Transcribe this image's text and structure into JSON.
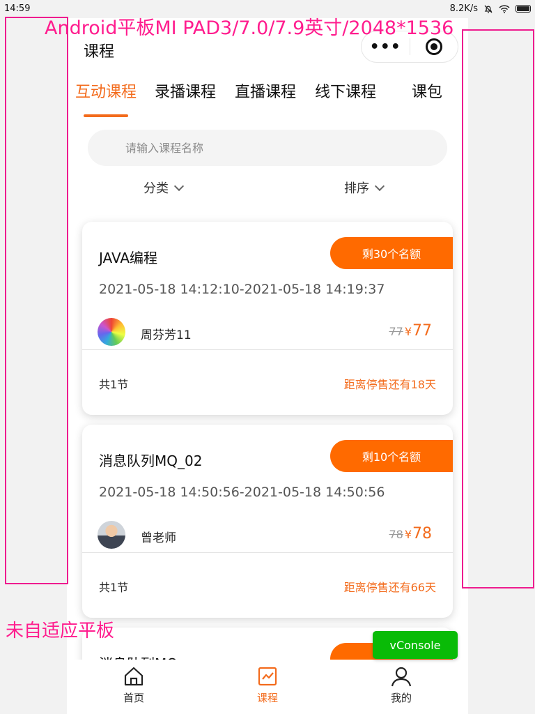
{
  "status_bar": {
    "time": "14:59",
    "net_speed": "8.2K/s"
  },
  "navbar": {
    "title": "课程",
    "more_label": "•••"
  },
  "tabs": [
    {
      "label": "互动课程",
      "active": true
    },
    {
      "label": "录播课程",
      "active": false
    },
    {
      "label": "直播课程",
      "active": false
    },
    {
      "label": "线下课程",
      "active": false
    },
    {
      "label": "课包",
      "active": false
    }
  ],
  "search": {
    "placeholder": "请输入课程名称",
    "value": ""
  },
  "filters": {
    "category": "分类",
    "sort": "排序"
  },
  "courses": [
    {
      "name": "JAVA编程",
      "quota": "剩30个名额",
      "time": "2021-05-18 14:12:10-2021-05-18 14:19:37",
      "teacher": "周芬芳11",
      "original_price": "77",
      "currency": "¥",
      "price": "77",
      "lessons": "共1节",
      "deadline": "距离停售还有18天"
    },
    {
      "name": "消息队列MQ_02",
      "quota": "剩10个名额",
      "time": "2021-05-18 14:50:56-2021-05-18 14:50:56",
      "teacher": "曾老师",
      "original_price": "78",
      "currency": "¥",
      "price": "78",
      "lessons": "共1节",
      "deadline": "距离停售还有66天"
    },
    {
      "name": "消息队列MQ",
      "quota": ""
    }
  ],
  "vconsole": "vConsole",
  "tabbar": [
    {
      "label": "首页",
      "icon": "home-icon",
      "active": false
    },
    {
      "label": "课程",
      "icon": "chart-icon",
      "active": true
    },
    {
      "label": "我的",
      "icon": "user-icon",
      "active": false
    }
  ],
  "annotations": {
    "title": "Android平板MI PAD3/7.0/7.9英寸/2048*1536",
    "note": "未自适应平板"
  },
  "colors": {
    "accent": "#f36b1c",
    "quota_bg": "#ff6a00",
    "annotation": "#ee1c8f",
    "vconsole": "#09bb07"
  }
}
